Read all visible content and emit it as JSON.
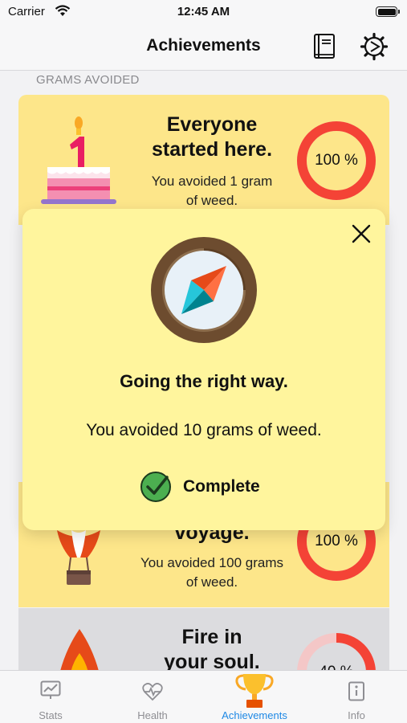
{
  "status_bar": {
    "carrier": "Carrier",
    "time": "12:45 AM"
  },
  "navbar": {
    "title": "Achievements",
    "icons": [
      "book-icon",
      "gear-icon"
    ]
  },
  "section_header": "GRAMS AVOIDED",
  "cards": [
    {
      "title_line1": "Everyone",
      "title_line2": "started here.",
      "desc_line1": "You avoided 1 gram",
      "desc_line2": "of weed.",
      "progress_label": "100 %",
      "progress": 1.0
    },
    {
      "title_line1": "voyage.",
      "desc_line1": "You avoided 100 grams",
      "desc_line2": "of weed.",
      "progress_label": "100 %",
      "progress": 1.0
    },
    {
      "title_line1": "Fire in",
      "title_line2": "your soul.",
      "progress_label": "40 %",
      "progress": 0.4
    }
  ],
  "modal": {
    "title": "Going the right way.",
    "description": "You avoided 10 grams of weed.",
    "status": "Complete"
  },
  "tabs": [
    {
      "label": "Stats",
      "icon": "stats-chart-icon",
      "active": false
    },
    {
      "label": "Health",
      "icon": "heartbeat-icon",
      "active": false
    },
    {
      "label": "Achievements",
      "icon": "trophy-icon",
      "active": true
    },
    {
      "label": "Info",
      "icon": "info-book-icon",
      "active": false
    }
  ],
  "colors": {
    "card_bg": "#fde68a",
    "modal_bg": "#fff59d",
    "ring_red": "#f44336",
    "accent_blue": "#1e88e5",
    "check_green": "#43a047"
  }
}
